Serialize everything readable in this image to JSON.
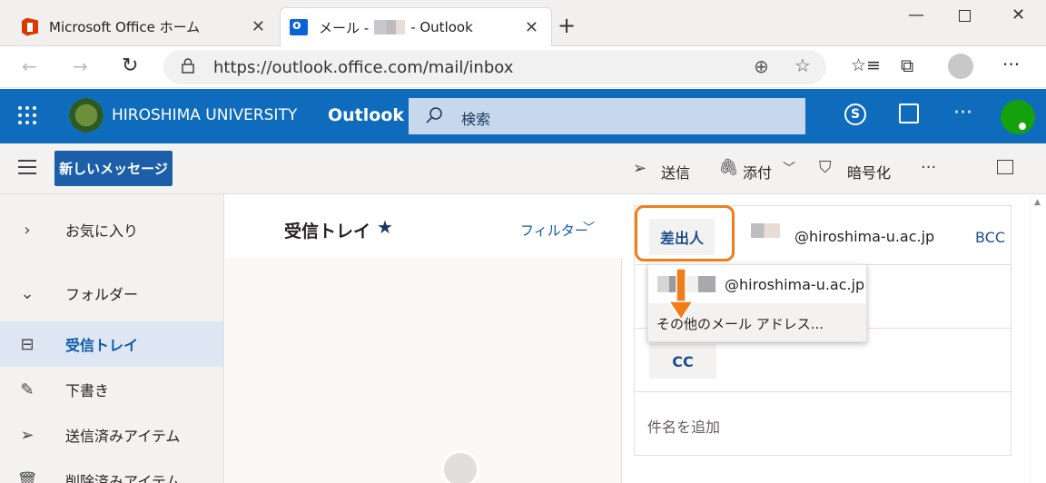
{
  "browser": {
    "tabs": [
      {
        "label": "Microsoft Office ホーム"
      },
      {
        "label_prefix": "メール -",
        "label_suffix": "- Outlook"
      }
    ],
    "new_tab": "+",
    "url": "https://outlook.office.com/mail/inbox"
  },
  "header": {
    "org_name": "HIROSHIMA UNIVERSITY",
    "app_name": "Outlook",
    "search_placeholder": "検索"
  },
  "commands": {
    "new_message": "新しいメッセージ",
    "send": "送信",
    "attach": "添付",
    "encrypt": "暗号化",
    "more": "···"
  },
  "nav": {
    "favorites": "お気に入り",
    "folders": "フォルダー",
    "items": [
      {
        "label": "受信トレイ",
        "selected": true
      },
      {
        "label": "下書き"
      },
      {
        "label": "送信済みアイテム"
      },
      {
        "label": "削除済みアイテム"
      }
    ]
  },
  "message_list": {
    "title": "受信トレイ",
    "star": "★",
    "filter": "フィルター"
  },
  "compose": {
    "from_label": "差出人",
    "from_domain": "@hiroshima-u.ac.jp",
    "bcc": "BCC",
    "cc": "CC",
    "subject_placeholder": "件名を追加"
  },
  "from_dropdown": {
    "account_domain": "@hiroshima-u.ac.jp",
    "other_address": "その他のメール アドレス..."
  },
  "colors": {
    "header": "#0f6cbd",
    "accent": "#1c5fa8",
    "highlight": "#f07c1a",
    "avatar": "#13a10e"
  }
}
